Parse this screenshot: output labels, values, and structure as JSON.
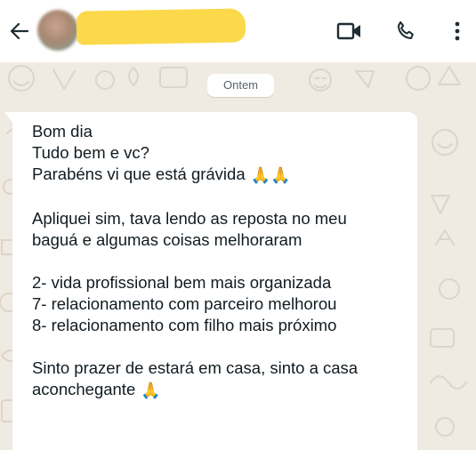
{
  "header": {
    "contact_name": "",
    "icons": [
      "back-arrow-icon",
      "avatar",
      "video-call-icon",
      "voice-call-icon",
      "more-options-icon"
    ]
  },
  "chat": {
    "date_divider": "Ontem",
    "message": {
      "lines": [
        {
          "text": "Bom dia",
          "emoji": ""
        },
        {
          "text": "Tudo bem e vc?",
          "emoji": ""
        },
        {
          "text": "Parabéns vi que está grávida",
          "emoji": "🙏🙏"
        },
        {
          "text": "",
          "emoji": ""
        },
        {
          "text": "Apliquei sim, tava lendo as reposta no meu",
          "emoji": ""
        },
        {
          "text": "baguá e algumas coisas melhoraram",
          "emoji": ""
        },
        {
          "text": "",
          "emoji": ""
        },
        {
          "text": "2- vida profissional bem mais organizada",
          "emoji": ""
        },
        {
          "text": "7- relacionamento com parceiro melhorou",
          "emoji": ""
        },
        {
          "text": "8- relacionamento com filho mais próximo",
          "emoji": ""
        },
        {
          "text": "",
          "emoji": ""
        },
        {
          "text": "Sinto prazer de estará em casa, sinto a casa",
          "emoji": ""
        },
        {
          "text": "aconchegante",
          "emoji": "🙏"
        }
      ]
    }
  },
  "colors": {
    "header_bg": "#ffffff",
    "chat_bg": "#efeae2",
    "bubble_bg": "#ffffff",
    "text": "#111b21",
    "redaction": "#fbd94a"
  }
}
